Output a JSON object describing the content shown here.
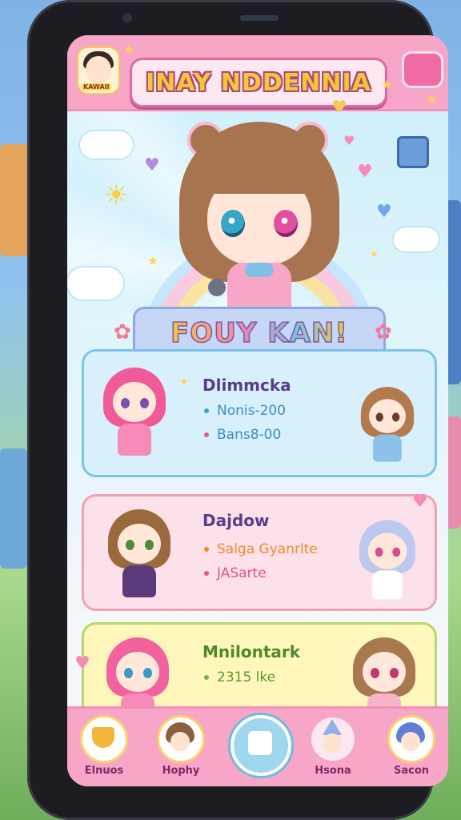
{
  "app": {
    "title": "INAY NDDENNIA",
    "avatar_tag": "KAWAII",
    "banner": "FOUY KAN!"
  },
  "cards": [
    {
      "name": "Dlimmcka",
      "stats": [
        "Nonis-200",
        "Bans8-00"
      ],
      "stat_colors": [
        "#3aa0d8",
        "#e0568f"
      ]
    },
    {
      "name": "Dajdow",
      "stats": [
        "Salga Gyanrlte",
        "JASarte"
      ],
      "stat_colors": [
        "#f28a2a",
        "#e0568f"
      ]
    },
    {
      "name": "Mnilontark",
      "stats": [
        "2315 lke"
      ],
      "stat_colors": [
        "#79b33a"
      ]
    }
  ],
  "nav": {
    "items": [
      {
        "label": "Elnuos"
      },
      {
        "label": "Hophy"
      },
      {
        "label": "Hsona"
      },
      {
        "label": "Sacon"
      }
    ]
  },
  "colors": {
    "header": "#f7a6c7",
    "card_blue": "#d8f0fc",
    "card_pink": "#fde1ea",
    "card_yellow": "#fff6bc"
  }
}
